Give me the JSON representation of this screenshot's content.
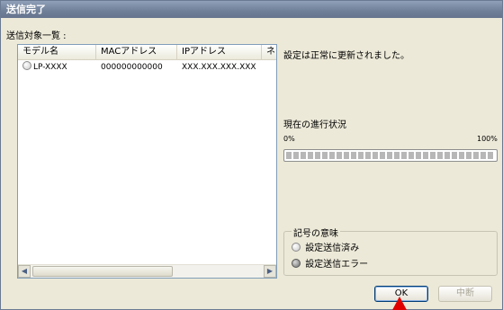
{
  "window": {
    "title": "送信完了"
  },
  "list": {
    "label": "送信対象一覧 :",
    "columns": [
      "モデル名",
      "MACアドレス",
      "IPアドレス",
      "ネ"
    ],
    "rows": [
      {
        "status": "complete",
        "model": "LP-XXXX",
        "mac": "000000000000",
        "ip": "XXX.XXX.XXX.XXX"
      }
    ]
  },
  "status": {
    "message": "設定は正常に更新されました。"
  },
  "progress": {
    "label": "現在の進行状況",
    "min_label": "0%",
    "max_label": "100%",
    "value": 1.0
  },
  "legend": {
    "title": "記号の意味",
    "items": [
      {
        "icon": "circle-light-icon",
        "label": "設定送信済み"
      },
      {
        "icon": "circle-dark-icon",
        "label": "設定送信エラー"
      }
    ]
  },
  "buttons": {
    "ok": "OK",
    "cancel": "中断"
  },
  "colors": {
    "titlebar": "#6f7f98",
    "dialog_bg": "#ece9d8",
    "cursor": "#e00000"
  }
}
